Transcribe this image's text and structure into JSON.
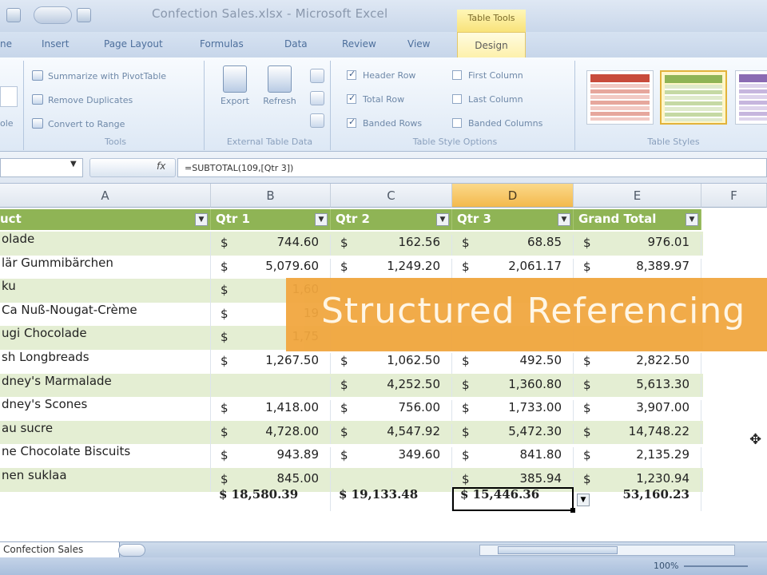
{
  "window": {
    "title": "Confection Sales.xlsx - Microsoft Excel",
    "contextual_label": "Table Tools"
  },
  "ribbon_tabs": [
    "ne",
    "Insert",
    "Page Layout",
    "Formulas",
    "Data",
    "Review",
    "View"
  ],
  "active_tab": "Design",
  "ribbon": {
    "properties_partial": [
      "",
      "ole"
    ],
    "tools": {
      "items": [
        "Summarize with PivotTable",
        "Remove Duplicates",
        "Convert to Range"
      ],
      "label": "Tools"
    },
    "external": {
      "export_label": "Export",
      "refresh_label": "Refresh",
      "label": "External Table Data"
    },
    "style_options": {
      "options": [
        {
          "label": "Header Row",
          "checked": true
        },
        {
          "label": "Total Row",
          "checked": true
        },
        {
          "label": "Banded Rows",
          "checked": true
        },
        {
          "label": "First Column",
          "checked": false
        },
        {
          "label": "Last Column",
          "checked": false
        },
        {
          "label": "Banded Columns",
          "checked": false
        }
      ],
      "label": "Table Style Options"
    },
    "styles": {
      "label": "Table Styles",
      "swatch_colors": [
        {
          "head": "#c84b3c",
          "c1": "#f2c9c3",
          "c2": "#e6a79d"
        },
        {
          "head": "#8fb455",
          "c1": "#dfeacb",
          "c2": "#c5d9a4"
        },
        {
          "head": "#8a6bb3",
          "c1": "#ddd3ec",
          "c2": "#c6b6de"
        }
      ]
    }
  },
  "formula_bar": {
    "name_box": "",
    "fx": "fx",
    "formula": "=SUBTOTAL(109,[Qtr 3])"
  },
  "columns": [
    "A",
    "B",
    "C",
    "D",
    "E",
    "F"
  ],
  "active_column": "D",
  "table": {
    "headers": [
      "uct",
      "Qtr 1",
      "Qtr 2",
      "Qtr 3",
      "Grand Total"
    ],
    "currency": "$",
    "rows": [
      {
        "name": "olade",
        "q1": "744.60",
        "q2": "162.56",
        "q3": "68.85",
        "total": "976.01"
      },
      {
        "name": "lär Gummibärchen",
        "q1": "5,079.60",
        "q2": "1,249.20",
        "q3": "2,061.17",
        "total": "8,389.97"
      },
      {
        "name": "ku",
        "q1": "1,60",
        "q2": "",
        "q3": "",
        "total": ""
      },
      {
        "name": "Ca Nuß-Nougat-Crème",
        "q1": "19",
        "q2": "",
        "q3": "",
        "total": ""
      },
      {
        "name": "ugi Chocolade",
        "q1": "1,75",
        "q2": "",
        "q3": "",
        "total": ""
      },
      {
        "name": "sh Longbreads",
        "q1": "1,267.50",
        "q2": "1,062.50",
        "q3": "492.50",
        "total": "2,822.50"
      },
      {
        "name": "dney's Marmalade",
        "q1": "",
        "q2": "4,252.50",
        "q3": "1,360.80",
        "total": "5,613.30"
      },
      {
        "name": "dney's Scones",
        "q1": "1,418.00",
        "q2": "756.00",
        "q3": "1,733.00",
        "total": "3,907.00"
      },
      {
        "name": "au sucre",
        "q1": "4,728.00",
        "q2": "4,547.92",
        "q3": "5,472.30",
        "total": "14,748.22"
      },
      {
        "name": "ne Chocolate Biscuits",
        "q1": "943.89",
        "q2": "349.60",
        "q3": "841.80",
        "total": "2,135.29"
      },
      {
        "name": "nen suklaa",
        "q1": "845.00",
        "q2": "",
        "q3": "385.94",
        "total": "1,230.94"
      }
    ],
    "totals": {
      "q1": "$ 18,580.39",
      "q2": "$ 19,133.48",
      "q3": "$ 15,446.36",
      "total": "53,160.23"
    }
  },
  "banner": "Structured Referencing",
  "sheet_tab": "Confection Sales",
  "status": {
    "zoom": "100%"
  }
}
